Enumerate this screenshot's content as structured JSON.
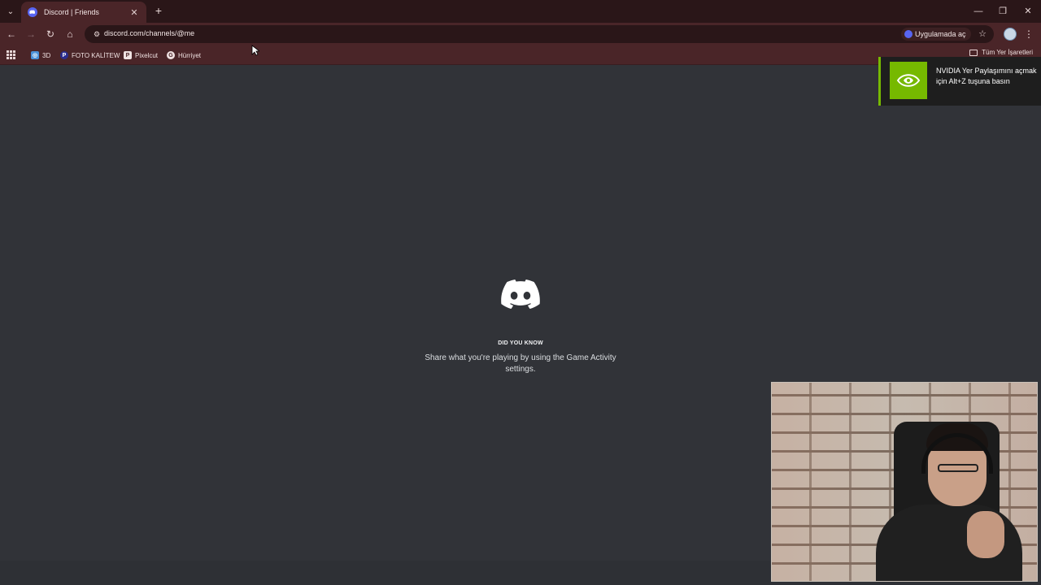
{
  "browser": {
    "tab": {
      "title": "Discord | Friends"
    },
    "url": "discord.com/channels/@me",
    "open_in_app_label": "Uygulamada aç",
    "bookmarks": [
      {
        "label": "3D",
        "icon": "3d-favicon"
      },
      {
        "label": "FOTO KALİTEW",
        "icon": "photo-favicon"
      },
      {
        "label": "Pixelcut",
        "icon": "pixelcut-favicon"
      },
      {
        "label": "Hürriyet",
        "icon": "hurriyet-favicon"
      }
    ],
    "all_bookmarks_label": "Tüm Yer İşaretleri"
  },
  "discord": {
    "did_you_know_title": "DID YOU KNOW",
    "did_you_know_text": "Share what you're playing by using the Game Activity settings."
  },
  "toast": {
    "text": "NVIDIA Yer Paylaşımını açmak için Alt+Z tuşuna basın",
    "accent": "#76b900"
  },
  "colors": {
    "titlebar": "#2a1618",
    "toolbar": "#4a2528",
    "discord_bg": "#313338",
    "blurple": "#5865f2"
  }
}
